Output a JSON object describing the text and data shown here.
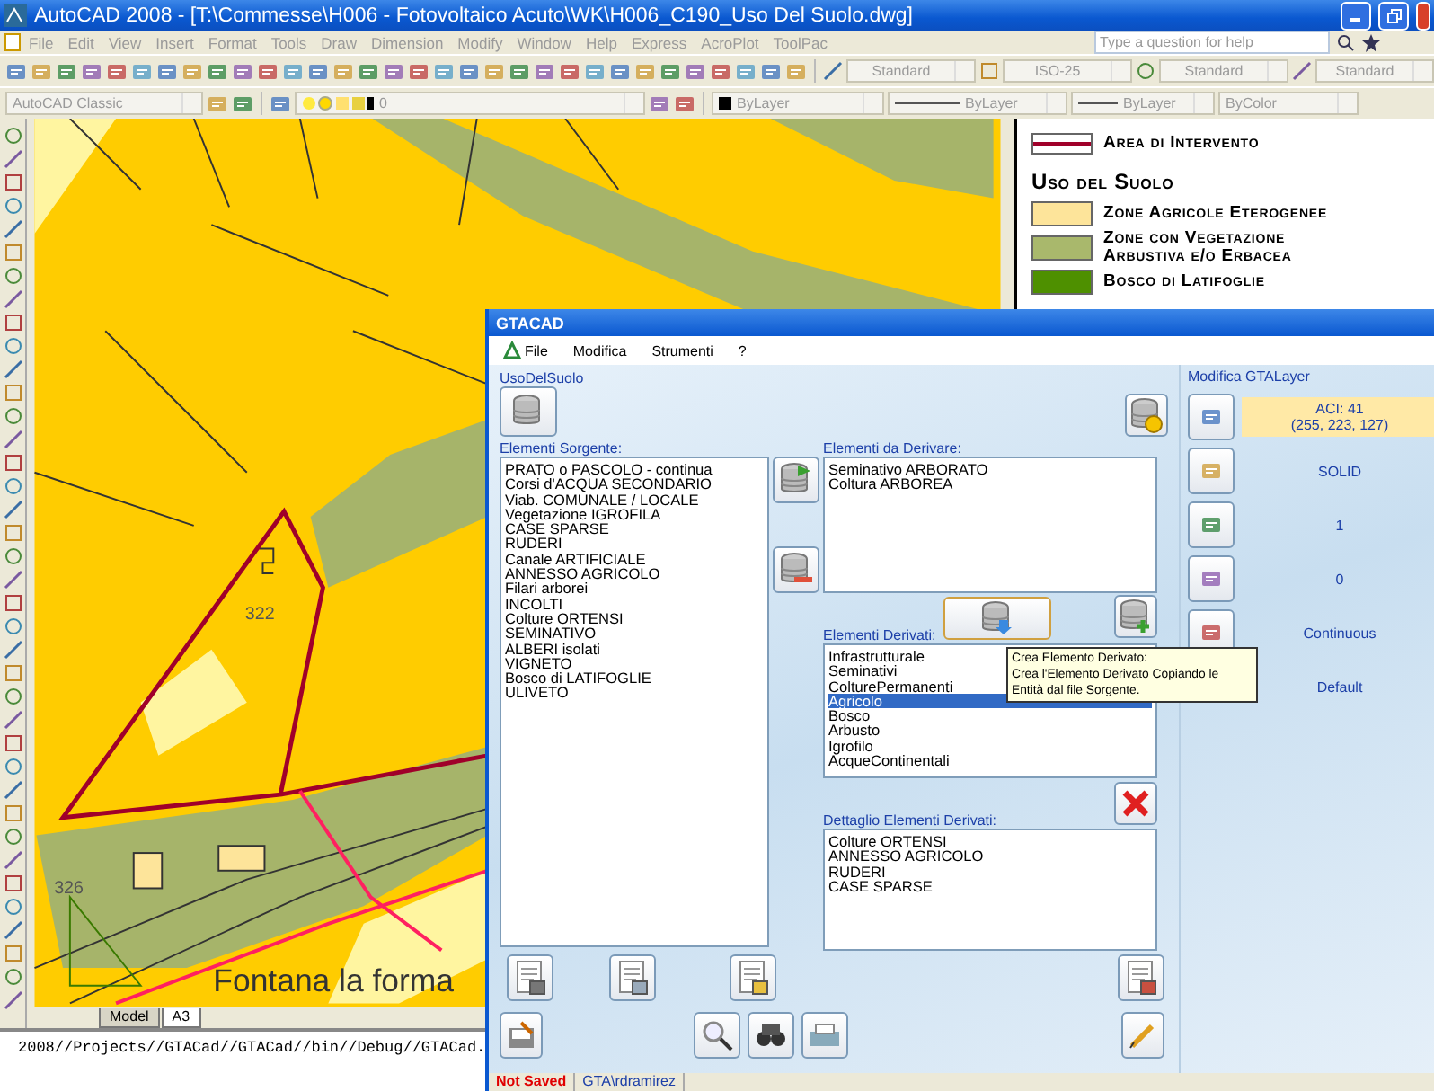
{
  "window": {
    "title": "AutoCAD 2008 - [T:\\Commesse\\H006 - Fotovoltaico Acuto\\WK\\H006_C190_Uso Del Suolo.dwg]"
  },
  "menu": [
    "File",
    "Edit",
    "View",
    "Insert",
    "Format",
    "Tools",
    "Draw",
    "Dimension",
    "Modify",
    "Window",
    "Help",
    "Express",
    "AcroPlot",
    "ToolPac"
  ],
  "help": {
    "placeholder": "Type a question for help"
  },
  "style_dropdowns": [
    "Standard",
    "ISO-25",
    "Standard",
    "Standard"
  ],
  "workspace": "AutoCAD Classic",
  "layer": "0",
  "property_dropdowns": [
    {
      "kind": "color",
      "text": "ByLayer"
    },
    {
      "kind": "line",
      "text": "ByLayer"
    },
    {
      "kind": "line",
      "text": "ByLayer"
    },
    {
      "kind": "plain",
      "text": "ByColor"
    }
  ],
  "drawing": {
    "labels": [
      "322",
      "326"
    ],
    "place_name": "Fontana la forma"
  },
  "layout_tabs": [
    {
      "label": "Model",
      "selected": false
    },
    {
      "label": "A3",
      "selected": true
    }
  ],
  "legend": {
    "boundary_label": "Area di Intervento",
    "heading": "Uso del Suolo",
    "items": [
      {
        "label": "Zone Agricole Eterogenee",
        "color": "#fde49a"
      },
      {
        "label": "Zone con Vegetazione Arbustiva e/o Erbacea",
        "color": "#a9b86c"
      },
      {
        "label": "Bosco di Latifoglie",
        "color": "#4e9000"
      }
    ]
  },
  "command_line": "2008//Projects//GTACad//GTACad//bin//Debug//GTACad.",
  "gtacad": {
    "title": "GTACAD",
    "menu": [
      "File",
      "Modifica",
      "Strumenti",
      "?"
    ],
    "group_title": "UsoDelSuolo",
    "source": {
      "label": "Elementi Sorgente:",
      "items": [
        "PRATO o PASCOLO - continua",
        "Corsi d'ACQUA SECONDARIO",
        "Viab. COMUNALE / LOCALE",
        "Vegetazione IGROFILA",
        "CASE SPARSE",
        "RUDERI",
        "Canale ARTIFICIALE",
        "ANNESSO AGRICOLO",
        "Filari arborei",
        "INCOLTI",
        "Colture ORTENSI",
        "SEMINATIVO",
        "ALBERI isolati",
        "VIGNETO",
        "Bosco di LATIFOGLIE",
        "ULIVETO"
      ]
    },
    "to_derive": {
      "label": "Elementi da Derivare:",
      "items": [
        "Seminativo ARBORATO",
        "Coltura ARBOREA"
      ]
    },
    "derived": {
      "label": "Elementi Derivati:",
      "items": [
        {
          "text": "Infrastrutturale",
          "selected": false
        },
        {
          "text": "Seminativi",
          "selected": false
        },
        {
          "text": "ColturePermanenti",
          "selected": false
        },
        {
          "text": "Agricolo",
          "selected": true
        },
        {
          "text": "Bosco",
          "selected": false
        },
        {
          "text": "Arbusto",
          "selected": false
        },
        {
          "text": "Igrofilo",
          "selected": false
        },
        {
          "text": "AcqueContinentali",
          "selected": false
        }
      ]
    },
    "detail": {
      "label": "Dettaglio Elementi Derivati:",
      "items": [
        "Colture ORTENSI",
        "ANNESSO AGRICOLO",
        "RUDERI",
        "CASE SPARSE"
      ]
    },
    "tooltip": {
      "title": "Crea Elemento Derivato:",
      "text": "Crea l'Elemento Derivato Copiando le Entità dal file Sorgente."
    },
    "layer_panel": {
      "title": "Modifica GTALayer",
      "aci": "ACI: 41",
      "rgb": "(255, 223, 127)",
      "values": [
        "SOLID",
        "1",
        "0",
        "Continuous",
        "Default"
      ]
    },
    "status": [
      {
        "kind": "warning",
        "text": "Not Saved"
      },
      {
        "kind": "user",
        "text": "GTA\\rdramirez"
      }
    ]
  }
}
